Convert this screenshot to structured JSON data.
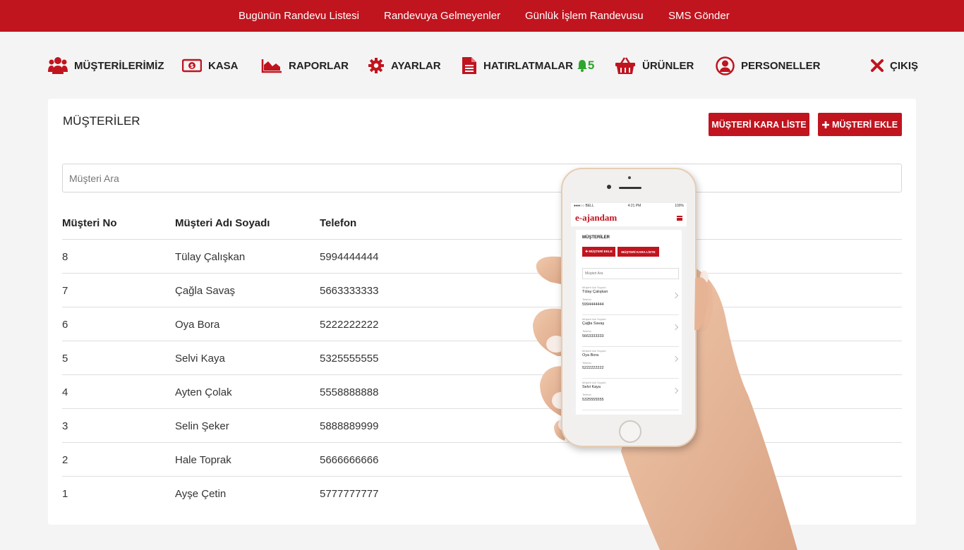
{
  "topnav": {
    "links": [
      "Bugünün Randevu Listesi",
      "Randevuya Gelmeyenler",
      "Günlük İşlem Randevusu",
      "SMS Gönder"
    ]
  },
  "mainnav": {
    "items": [
      "MÜŞTERİLERİMİZ",
      "KASA",
      "RAPORLAR",
      "AYARLAR",
      "HATIRLATMALAR",
      "ÜRÜNLER",
      "PERSONELLER"
    ],
    "reminder_count": "5",
    "logout": "ÇIKIŞ"
  },
  "page": {
    "title": "MÜŞTERİLER",
    "blacklist_button": "MÜŞTERİ KARA LİSTE",
    "add_button": "MÜŞTERİ EKLE",
    "search_placeholder": "Müşteri Ara"
  },
  "table": {
    "headers": [
      "Müşteri No",
      "Müşteri Adı Soyadı",
      "Telefon"
    ],
    "rows": [
      [
        "8",
        "Tülay Çalışkan",
        "5994444444"
      ],
      [
        "7",
        "Çağla Savaş",
        "5663333333"
      ],
      [
        "6",
        "Oya Bora",
        "5222222222"
      ],
      [
        "5",
        "Selvi Kaya",
        "5325555555"
      ],
      [
        "4",
        "Ayten Çolak",
        "5558888888"
      ],
      [
        "3",
        "Selin Şeker",
        "5888889999"
      ],
      [
        "2",
        "Hale Toprak",
        "5666666666"
      ],
      [
        "1",
        "Ayşe Çetin",
        "5777777777"
      ]
    ]
  },
  "phone": {
    "carrier": "●●●○○ BELL",
    "time": "4:21 PM",
    "battery": "100%",
    "logo": "e-ajandam",
    "title": "MÜŞTERİLER",
    "add_button": "✚ MÜŞTERİ EKLE",
    "blacklist_button": "MÜŞTERİ KARA LİSTE",
    "search_placeholder": "Müşteri Ara",
    "name_label": "Müşteri Adı Soyadı",
    "phone_label": "Telefon",
    "items": [
      {
        "name": "Tülay Çalışkan",
        "phone": "5994444444"
      },
      {
        "name": "Çağla Savaş",
        "phone": "5663333333"
      },
      {
        "name": "Oya Bora",
        "phone": "5222222222"
      },
      {
        "name": "Selvi Kaya",
        "phone": "5325555555"
      }
    ]
  },
  "colors": {
    "brand_red": "#c0141f",
    "badge_green": "#2ea52e"
  }
}
